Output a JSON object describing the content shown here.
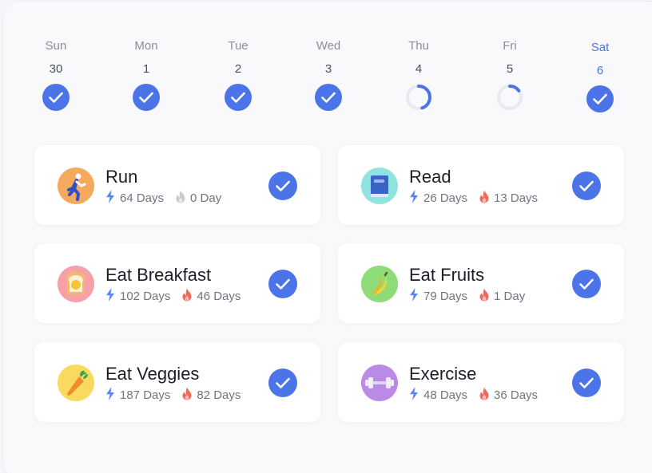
{
  "week": [
    {
      "name": "Sun",
      "date": "30",
      "status": "done"
    },
    {
      "name": "Mon",
      "date": "1",
      "status": "done"
    },
    {
      "name": "Tue",
      "date": "2",
      "status": "done"
    },
    {
      "name": "Wed",
      "date": "3",
      "status": "done"
    },
    {
      "name": "Thu",
      "date": "4",
      "status": "partial",
      "progress": 0.45
    },
    {
      "name": "Fri",
      "date": "5",
      "status": "partial",
      "progress": 0.15
    },
    {
      "name": "Sat",
      "date": "6",
      "status": "done",
      "active": true
    }
  ],
  "habits": [
    {
      "title": "Run",
      "total": "64 Days",
      "streak": "0 Day",
      "streak_active": false,
      "icon": "running-person-icon",
      "icon_bg": "#f5a95c",
      "done": true
    },
    {
      "title": "Read",
      "total": "26 Days",
      "streak": "13 Days",
      "streak_active": true,
      "icon": "book-icon",
      "icon_bg": "#8fe3e0",
      "done": true
    },
    {
      "title": "Eat Breakfast",
      "total": "102 Days",
      "streak": "46 Days",
      "streak_active": true,
      "icon": "toast-egg-icon",
      "icon_bg": "#f7a0a8",
      "done": true
    },
    {
      "title": "Eat Fruits",
      "total": "79 Days",
      "streak": "1 Day",
      "streak_active": true,
      "icon": "banana-icon",
      "icon_bg": "#8ddc78",
      "done": true
    },
    {
      "title": "Eat Veggies",
      "total": "187 Days",
      "streak": "82 Days",
      "streak_active": true,
      "icon": "carrot-icon",
      "icon_bg": "#f9da5f",
      "done": true
    },
    {
      "title": "Exercise",
      "total": "48 Days",
      "streak": "36 Days",
      "streak_active": true,
      "icon": "dumbbell-icon",
      "icon_bg": "#b98be6",
      "done": true
    }
  ],
  "colors": {
    "accent": "#4a74e8",
    "bolt": "#5b86f0",
    "flame_active": "#f06a5c",
    "flame_inactive": "#c8cad2",
    "ring_track": "#e8eaf0"
  }
}
